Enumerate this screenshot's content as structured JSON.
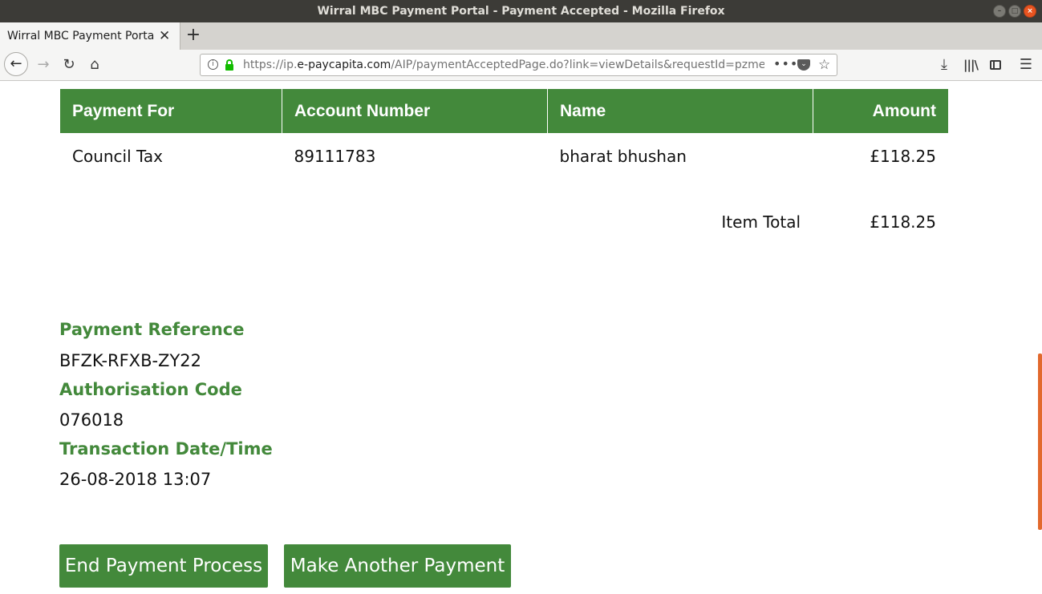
{
  "window": {
    "title": "Wirral MBC Payment Portal - Payment Accepted - Mozilla Firefox"
  },
  "browser": {
    "tab_title": "Wirral MBC Payment Portal",
    "url_scheme": "https://ip.",
    "url_host": "e-paycapita.com",
    "url_path": "/AIP/paymentAcceptedPage.do?link=viewDetails&requestId=pzme",
    "icons": {
      "back": "back-arrow-icon",
      "forward": "forward-arrow-icon",
      "reload": "reload-icon",
      "home": "home-icon",
      "info": "info-icon",
      "lock": "lock-icon",
      "more": "more-icon",
      "pocket": "pocket-icon",
      "star": "star-icon",
      "download": "download-icon",
      "library": "library-icon",
      "sidebar": "sidebar-icon",
      "menu": "menu-icon"
    }
  },
  "table": {
    "headers": [
      "Payment For",
      "Account Number",
      "Name",
      "Amount"
    ],
    "rows": [
      [
        "Council Tax",
        "89111783",
        "bharat bhushan",
        "£118.25"
      ]
    ],
    "total_label": "Item Total",
    "total_value": "£118.25"
  },
  "details": {
    "reference_label": "Payment Reference",
    "reference_value": "BFZK-RFXB-ZY22",
    "auth_label": "Authorisation Code",
    "auth_value": "076018",
    "date_label": "Transaction Date/Time",
    "date_value": "26-08-2018 13:07"
  },
  "actions": {
    "end_label": "End Payment Process",
    "another_label": "Make Another Payment"
  },
  "colors": {
    "brand_green": "#43893b",
    "titlebar": "#3c3b37",
    "secure_lock": "#12bc00",
    "scroll_thumb": "#e2692d"
  }
}
